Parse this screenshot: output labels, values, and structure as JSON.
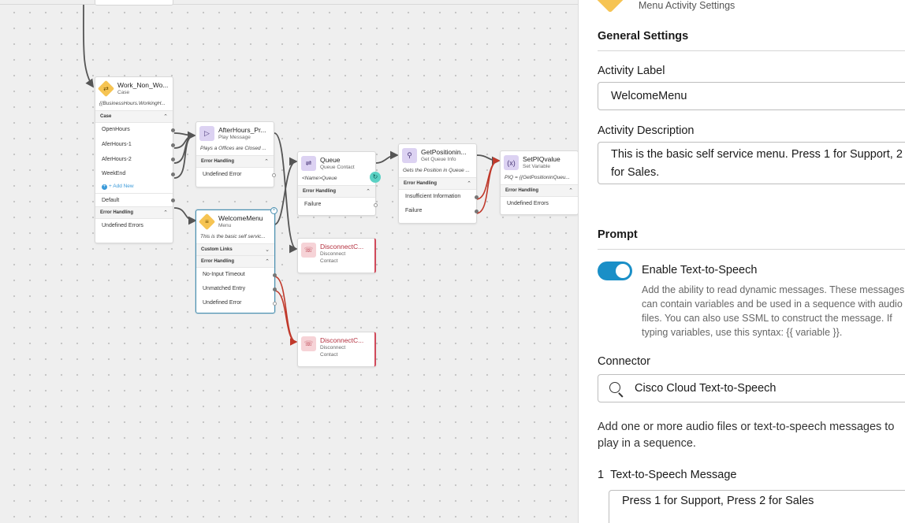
{
  "canvas": {
    "nodes": {
      "case": {
        "title": "Work_Non_Wo...",
        "type": "Case",
        "desc": "{{BusinessHours.WorkingH...",
        "section": "Case",
        "rows": [
          "OpenHours",
          "AferHours-1",
          "AferHours-2",
          "WeekEnd"
        ],
        "add_new": "+ Add New",
        "default": "Default",
        "error_section": "Error Handling",
        "error_rows": [
          "Undefined Errors"
        ]
      },
      "afterhours": {
        "title": "AfterHours_Pr...",
        "type": "Play Message",
        "desc": "Plays a Offices are Closed ...",
        "error_section": "Error Handling",
        "error_rows": [
          "Undefined Error"
        ]
      },
      "welcome": {
        "title": "WelcomeMenu",
        "type": "Menu",
        "desc": "This is the basic self servic...",
        "custom_section": "Custom Links",
        "error_section": "Error Handling",
        "error_rows": [
          "No-Input Timeout",
          "Unmatched Entry",
          "Undefined Error"
        ]
      },
      "queue": {
        "title": "Queue",
        "type": "Queue Contact",
        "desc": "<Name>Queue",
        "error_section": "Error Handling",
        "error_rows": [
          "Failure"
        ]
      },
      "getpos": {
        "title": "GetPositionin...",
        "type": "Get Queue Info",
        "desc": "Gets the Position in Queue ...",
        "error_section": "Error Handling",
        "error_rows": [
          "Insufficient Information",
          "Failure"
        ]
      },
      "setpiq": {
        "title": "SetPIQvalue",
        "type": "Set Variable",
        "desc": "PIQ = {{GetPositioninQueu...",
        "error_section": "Error Handling",
        "error_rows": [
          "Undefined Errors"
        ]
      },
      "disconnect1": {
        "title": "DisconnectC...",
        "type": "Disconnect",
        "type2": "Contact"
      },
      "disconnect2": {
        "title": "DisconnectC...",
        "type": "Disconnect",
        "type2": "Contact"
      }
    },
    "icons": {
      "case": "share-branch-icon",
      "play": "play-icon",
      "menu": "list-icon",
      "queue": "shuffle-icon",
      "getpos": "search-icon",
      "setvar": "variable-icon",
      "disconnect": "phone-hangup-icon"
    },
    "colors": {
      "wire": "#555555",
      "error_wire": "#c0392b",
      "selected": "#4a8fb0",
      "disconnect_accent": "#d0495a"
    }
  },
  "panel": {
    "header": "Menu Activity Settings",
    "general_title": "General Settings",
    "label_label": "Activity Label",
    "label_value": "WelcomeMenu",
    "desc_label": "Activity Description",
    "desc_value": "This is the basic self service menu. Press 1 for Support, 2 for Sales.",
    "prompt_title": "Prompt",
    "tts_toggle_label": "Enable Text-to-Speech",
    "tts_toggle_on": true,
    "tts_help": "Add the ability to read dynamic messages. These messages can contain variables and be used in a sequence with audio files. You can also use SSML to construct the message. If typing variables, use this syntax: {{ variable }}.",
    "connector_label": "Connector",
    "connector_value": "Cisco Cloud Text-to-Speech",
    "audio_help": "Add one or more audio files or text-to-speech messages to play in a sequence.",
    "tts_item_number": "1",
    "tts_item_title": "Text-to-Speech Message",
    "tts_item_value": "Press 1 for Support, Press 2 for Sales",
    "accent_color": "#1a8fc7"
  }
}
